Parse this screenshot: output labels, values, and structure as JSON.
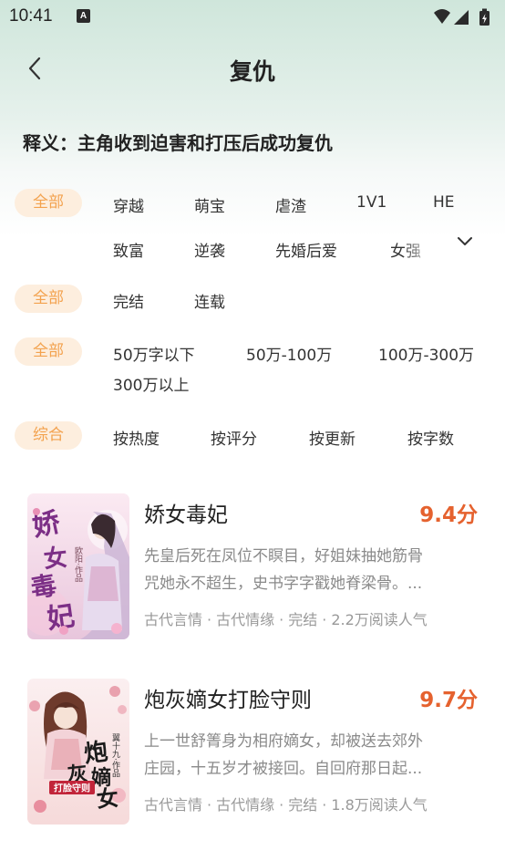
{
  "status_bar": {
    "time": "10:41",
    "notification_icon": "A",
    "icons": [
      "wifi-icon",
      "signal-icon",
      "battery-charging-icon"
    ]
  },
  "header": {
    "back_icon": "chevron-left-icon",
    "title": "复仇"
  },
  "definition": "释义：主角收到迫害和打压后成功复仇",
  "filters": {
    "genre": {
      "all_label": "全部",
      "row1": [
        "穿越",
        "萌宝",
        "虐渣",
        "1V1",
        "HE"
      ],
      "row2": [
        "致富",
        "逆袭",
        "先婚后爱",
        "女强"
      ],
      "expand_icon": "chevron-down-icon"
    },
    "status": {
      "all_label": "全部",
      "options": [
        "完结",
        "连载"
      ]
    },
    "word_count": {
      "all_label": "全部",
      "row1": [
        "50万字以下",
        "50万-100万",
        "100万-300万"
      ],
      "row2": [
        "300万以上"
      ]
    },
    "sort": {
      "selected_label": "综合",
      "options": [
        "按热度",
        "按评分",
        "按更新",
        "按字数"
      ]
    }
  },
  "books": [
    {
      "title": "娇女毒妃",
      "score": "9.4分",
      "desc_line1": "先皇后死在凤位不瞑目，好姐妹抽她筋骨",
      "desc_line2": "咒她永不超生，史书字字戳她脊梁骨。...",
      "meta": [
        "古代言情",
        "古代情缘",
        "完结",
        "2.2万阅读人气"
      ],
      "meta_sep": "·",
      "cover_text": [
        "娇",
        "女",
        "毒",
        "妃"
      ],
      "cover_author": "欧阳·作品"
    },
    {
      "title": "炮灰嫡女打脸守则",
      "score": "9.7分",
      "desc_line1": "上一世舒箐身为相府嫡女，却被送去郊外",
      "desc_line2": "庄园，十五岁才被接回。自回府那日起...",
      "meta": [
        "古代言情",
        "古代情缘",
        "完结",
        "1.8万阅读人气"
      ],
      "meta_sep": "·",
      "cover_text": [
        "炮",
        "灰",
        "嫡",
        "女"
      ],
      "cover_banner": "打脸守则",
      "cover_author": "翼十九·作品"
    }
  ],
  "colors": {
    "accent": "#f3a24e",
    "pill_bg": "#fdeede",
    "score": "#e5622f",
    "header_bg": "#cfe6db"
  }
}
